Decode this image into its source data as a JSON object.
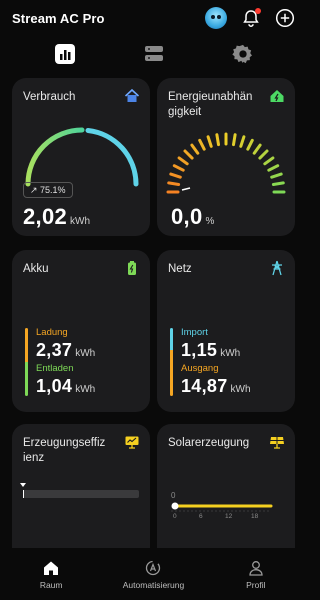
{
  "header": {
    "title": "Stream AC Pro"
  },
  "cards": {
    "verbrauch": {
      "title": "Verbrauch",
      "badge": "↗ 75.1%",
      "value": "2,02",
      "unit": "kWh"
    },
    "energieunabhaengigkeit": {
      "title_line1": "Energieunabhän",
      "title_line2": "gigkeit",
      "value": "0,0",
      "unit": "%"
    },
    "akku": {
      "title": "Akku",
      "ladung_label": "Ladung",
      "ladung_value": "2,37",
      "ladung_unit": "kWh",
      "entladen_label": "Entladen",
      "entladen_value": "1,04",
      "entladen_unit": "kWh"
    },
    "netz": {
      "title": "Netz",
      "import_label": "Import",
      "import_value": "1,15",
      "import_unit": "kWh",
      "ausgang_label": "Ausgang",
      "ausgang_value": "14,87",
      "ausgang_unit": "kWh"
    },
    "erzeugungseffizienz": {
      "title_line1": "Erzeugungseffiz",
      "title_line2": "ienz"
    },
    "solarerzeugung": {
      "title": "Solarerzeugung",
      "y_tick": "0",
      "x_ticks": [
        "0",
        "6",
        "12",
        "18"
      ]
    }
  },
  "bottom_nav": {
    "items": [
      {
        "label": "Raum"
      },
      {
        "label": "Automatisierung"
      },
      {
        "label": "Profil"
      }
    ]
  },
  "colors": {
    "background": "#0a0a0a",
    "card": "#1c1c1e",
    "orange": "#f5a623",
    "green": "#7ed957",
    "cyan": "#5fd3e8",
    "yellow": "#f5d020"
  }
}
